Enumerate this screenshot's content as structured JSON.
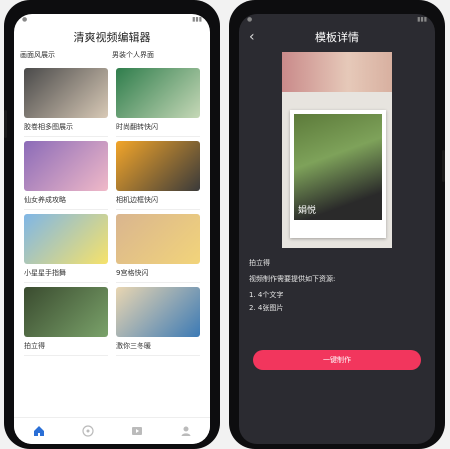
{
  "left": {
    "title": "清爽视频编辑器",
    "peek": [
      "画面风展示",
      "男装个人界面"
    ],
    "templates": [
      {
        "label": "胶卷相多图展示",
        "colors": [
          "#4a4a4a",
          "#d8c9b6"
        ]
      },
      {
        "label": "时尚翻转快闪",
        "colors": [
          "#2f7d4c",
          "#c6d8b7"
        ]
      },
      {
        "label": "仙女养成攻略",
        "colors": [
          "#8b6bb8",
          "#f0b9c8"
        ]
      },
      {
        "label": "相机边框快闪",
        "colors": [
          "#f2a52a",
          "#3a3a3a"
        ]
      },
      {
        "label": "小星星手指舞",
        "colors": [
          "#7fb6e6",
          "#f6e26a"
        ]
      },
      {
        "label": "9宫格快闪",
        "colors": [
          "#d9b58f",
          "#f2d47a"
        ]
      },
      {
        "label": "拍立得",
        "colors": [
          "#3a4b2f",
          "#7aa26a"
        ]
      },
      {
        "label": "激你三冬暖",
        "colors": [
          "#e9d6b2",
          "#3c7ab5"
        ]
      }
    ],
    "tabs": [
      "home-icon",
      "discover-icon",
      "video-icon",
      "profile-icon"
    ]
  },
  "right": {
    "title": "模板详情",
    "back_icon": "‹",
    "preview_name": "娟悦",
    "template_name": "拍立得",
    "requirement": "视频制作需要提供如下资源:",
    "items": [
      "1. 4个文字",
      "2. 4张图片"
    ],
    "button": "一键制作",
    "accent": "#f2365d"
  }
}
